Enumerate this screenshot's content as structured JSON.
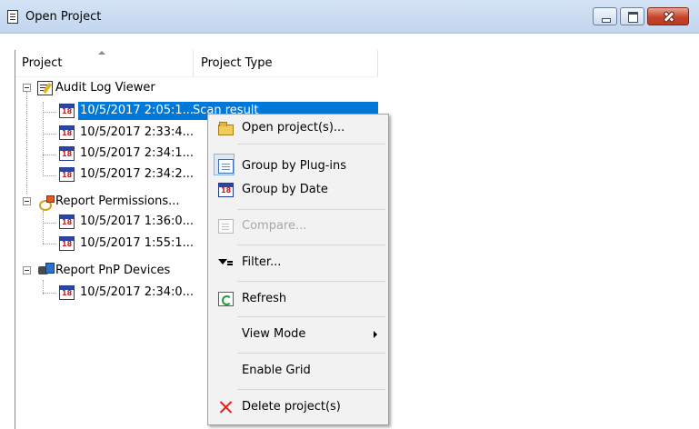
{
  "window": {
    "title": "Open Project"
  },
  "columns": {
    "project": "Project",
    "project_type": "Project Type"
  },
  "tree": {
    "groups": [
      {
        "label": "Audit Log Viewer",
        "icon": "notepad-icon",
        "children": [
          {
            "label": "10/5/2017 2:05:1...",
            "type": "Scan result",
            "selected": true
          },
          {
            "label": "10/5/2017 2:33:4...",
            "type": ""
          },
          {
            "label": "10/5/2017 2:34:1...",
            "type": ""
          },
          {
            "label": "10/5/2017 2:34:2...",
            "type": ""
          }
        ]
      },
      {
        "label": "Report Permissions...",
        "icon": "keys-icon",
        "children": [
          {
            "label": "10/5/2017 1:36:0...",
            "type": ""
          },
          {
            "label": "10/5/2017 1:55:1...",
            "type": ""
          }
        ]
      },
      {
        "label": "Report PnP Devices",
        "icon": "pnp-devices-icon",
        "children": [
          {
            "label": "10/5/2017 2:34:0...",
            "type": ""
          }
        ]
      }
    ]
  },
  "context_menu": {
    "open_projects": "Open project(s)...",
    "group_by_plugins": "Group by Plug-ins",
    "group_by_date": "Group by Date",
    "compare": "Compare...",
    "filter": "Filter...",
    "refresh": "Refresh",
    "view_mode": "View Mode",
    "enable_grid": "Enable Grid",
    "delete_projects": "Delete project(s)"
  },
  "colors": {
    "selection": "#0078d7",
    "titlebar": "#c9dcf2",
    "menu_background": "#f2f2f2",
    "delete_icon": "#e8201c"
  }
}
